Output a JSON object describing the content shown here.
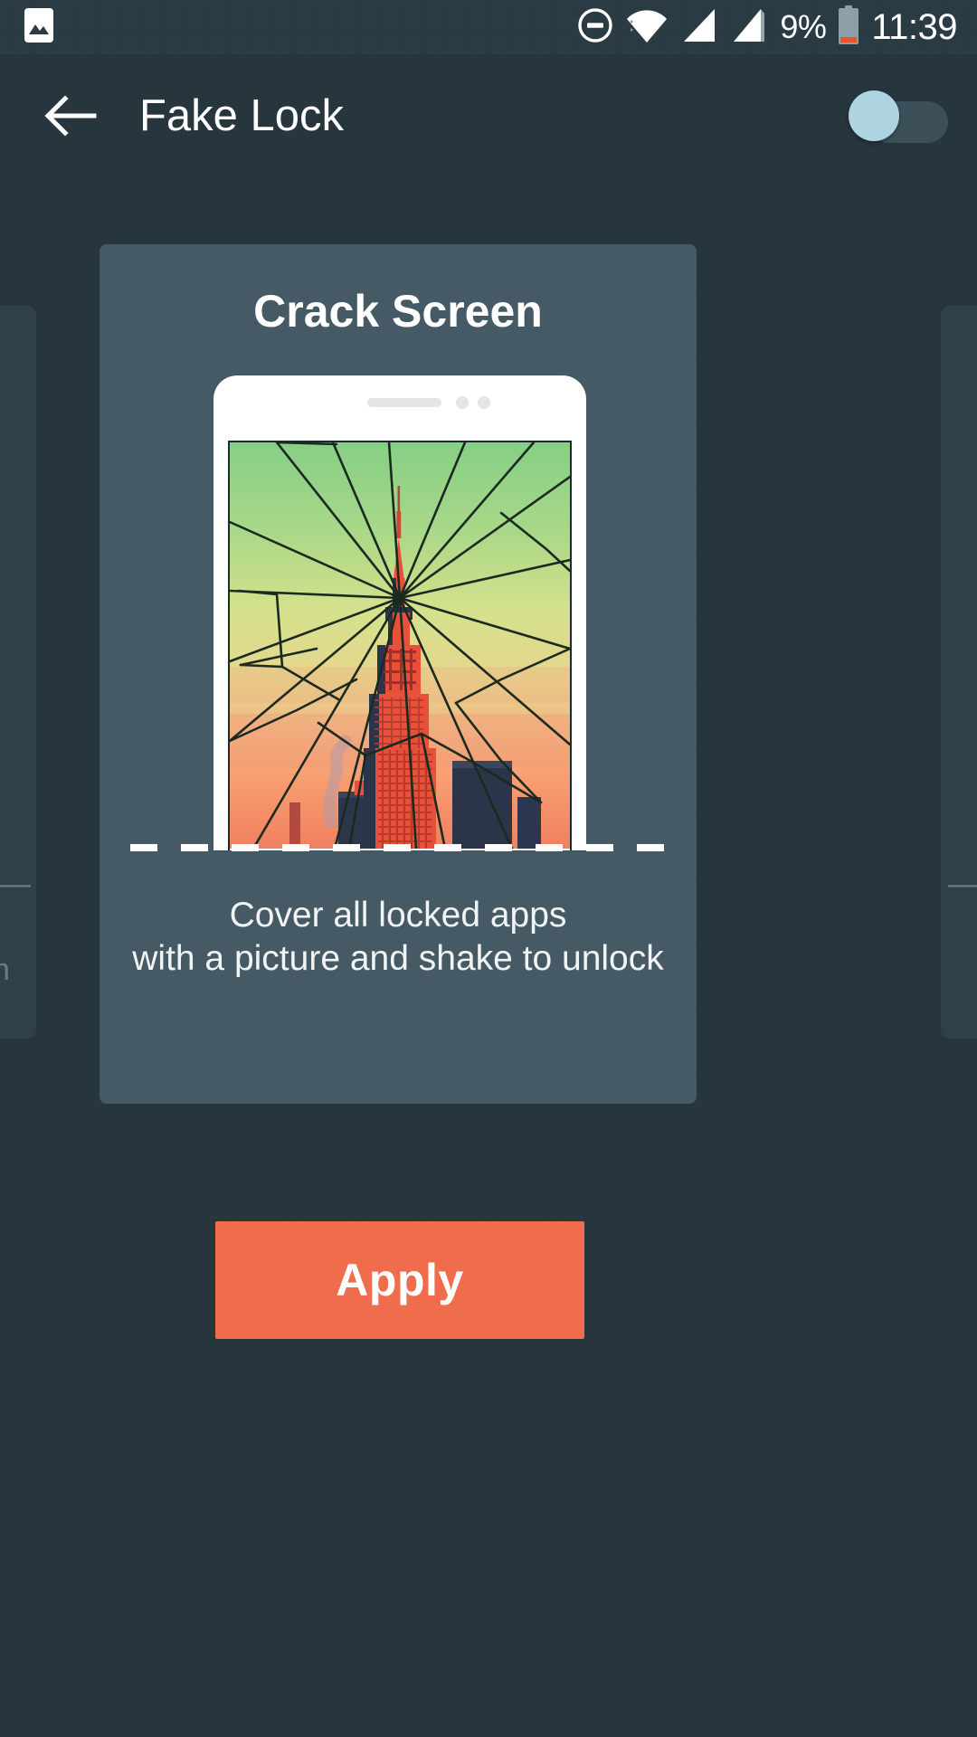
{
  "status_bar": {
    "left_icons": [
      {
        "name": "image-icon",
        "glyph": "image"
      }
    ],
    "right_icons": [
      {
        "name": "do-not-disturb-icon",
        "glyph": "dnd"
      },
      {
        "name": "wifi-icon",
        "glyph": "wifi"
      },
      {
        "name": "signal-sim1-icon",
        "glyph": "signal"
      },
      {
        "name": "signal-sim2-icon",
        "glyph": "signal"
      },
      {
        "name": "battery-icon",
        "glyph": "battery"
      }
    ],
    "battery_percent": "9%",
    "clock": "11:39"
  },
  "app_bar": {
    "back_label": "back-arrow",
    "title": "Fake Lock",
    "toggle": {
      "name": "fake-lock-master-toggle",
      "state": "off",
      "thumb_color": "#aed4e2",
      "track_color": "#3d5059"
    }
  },
  "carousel": {
    "main_card": {
      "title": "Crack Screen",
      "description": "Cover all locked apps\nwith a picture and shake to unlock",
      "preview": {
        "name": "cracked-screen-phone-preview",
        "subject": "empire-state-building-sunset",
        "sky_top_color": "#8fd18a",
        "sky_mid_color": "#dbe08a",
        "sky_bottom_color": "#f58a62",
        "building_color": "#e8503a",
        "crack_color": "#1d2a22"
      }
    },
    "left_peek_card": {
      "dash": "—",
      "partial_word": "n"
    },
    "right_peek_card": {
      "dash": "—"
    }
  },
  "footer": {
    "apply_label": "Apply",
    "apply_color": "#ef6c4d"
  },
  "colors": {
    "background": "#27353d",
    "status_bar": "#2b3b44",
    "card": "#455a64",
    "accent": "#ef6c4d",
    "toggle_thumb": "#aed4e2",
    "text_primary": "#ffffff"
  }
}
